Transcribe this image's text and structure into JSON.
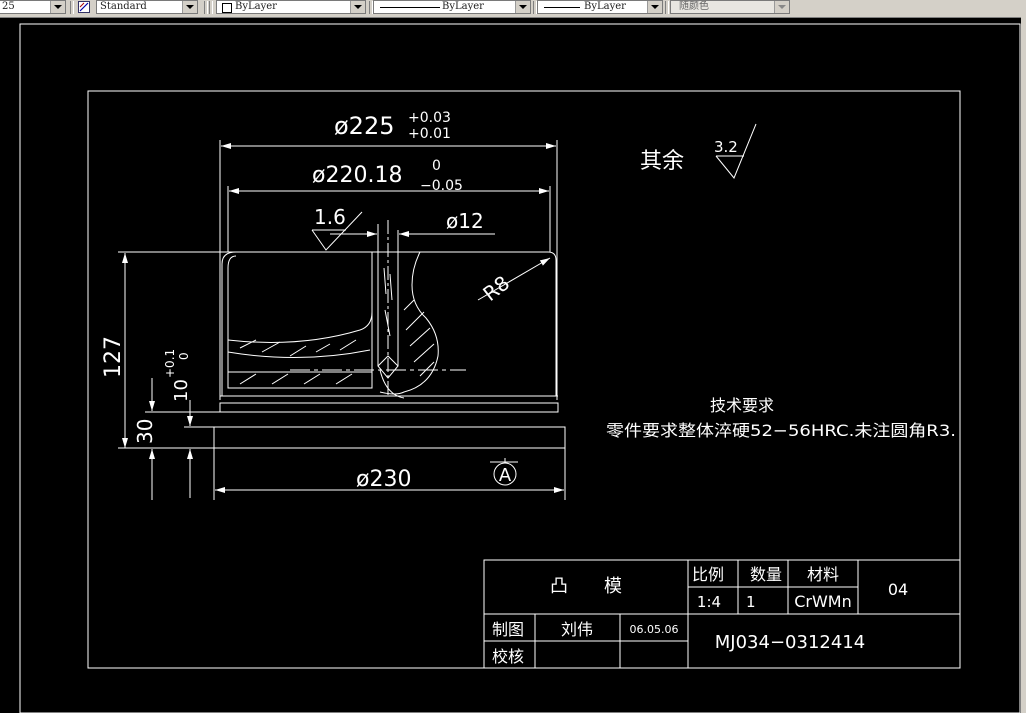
{
  "toolbar": {
    "textstyle_value": "25",
    "dimstyle_value": "Standard",
    "layer_value": "ByLayer",
    "linetype_value": "ByLayer",
    "lineweight_value": "ByLayer",
    "plotstyle_value": "随颜色"
  },
  "drawing": {
    "dim_225": "ø225",
    "tol_225_upper": "+0.03",
    "tol_225_lower": "+0.01",
    "dim_220": "ø220.18",
    "tol_220_upper": "0",
    "tol_220_lower": "−0.05",
    "rough_16": "1.6",
    "dim_12": "ø12",
    "radius_r8": "R8",
    "dim_127": "127",
    "dim_10": "10",
    "tol_10_upper": "+0.1",
    "tol_10_lower": "0",
    "dim_30": "30",
    "dim_230": "ø230",
    "datum_a": "A",
    "rest_label": "其余",
    "rough_32": "3.2",
    "tech_title": "技术要求",
    "tech_text": "零件要求整体淬硬52−56HRC.未注圆角R3."
  },
  "title_block": {
    "part_name": "凸　　模",
    "scale_label": "比例",
    "qty_label": "数量",
    "material_label": "材料",
    "sheet_no": "04",
    "scale_value": "1:4",
    "qty_value": "1",
    "material_value": "CrWMn",
    "drawn_label": "制图",
    "drawn_by": "刘伟",
    "date": "06.05.06",
    "checked_label": "校核",
    "drawing_no": "MJ034−0312414"
  },
  "colors": {
    "background": "#000000",
    "lines": "#ffffff",
    "toolbar": "#d4d0c8"
  }
}
